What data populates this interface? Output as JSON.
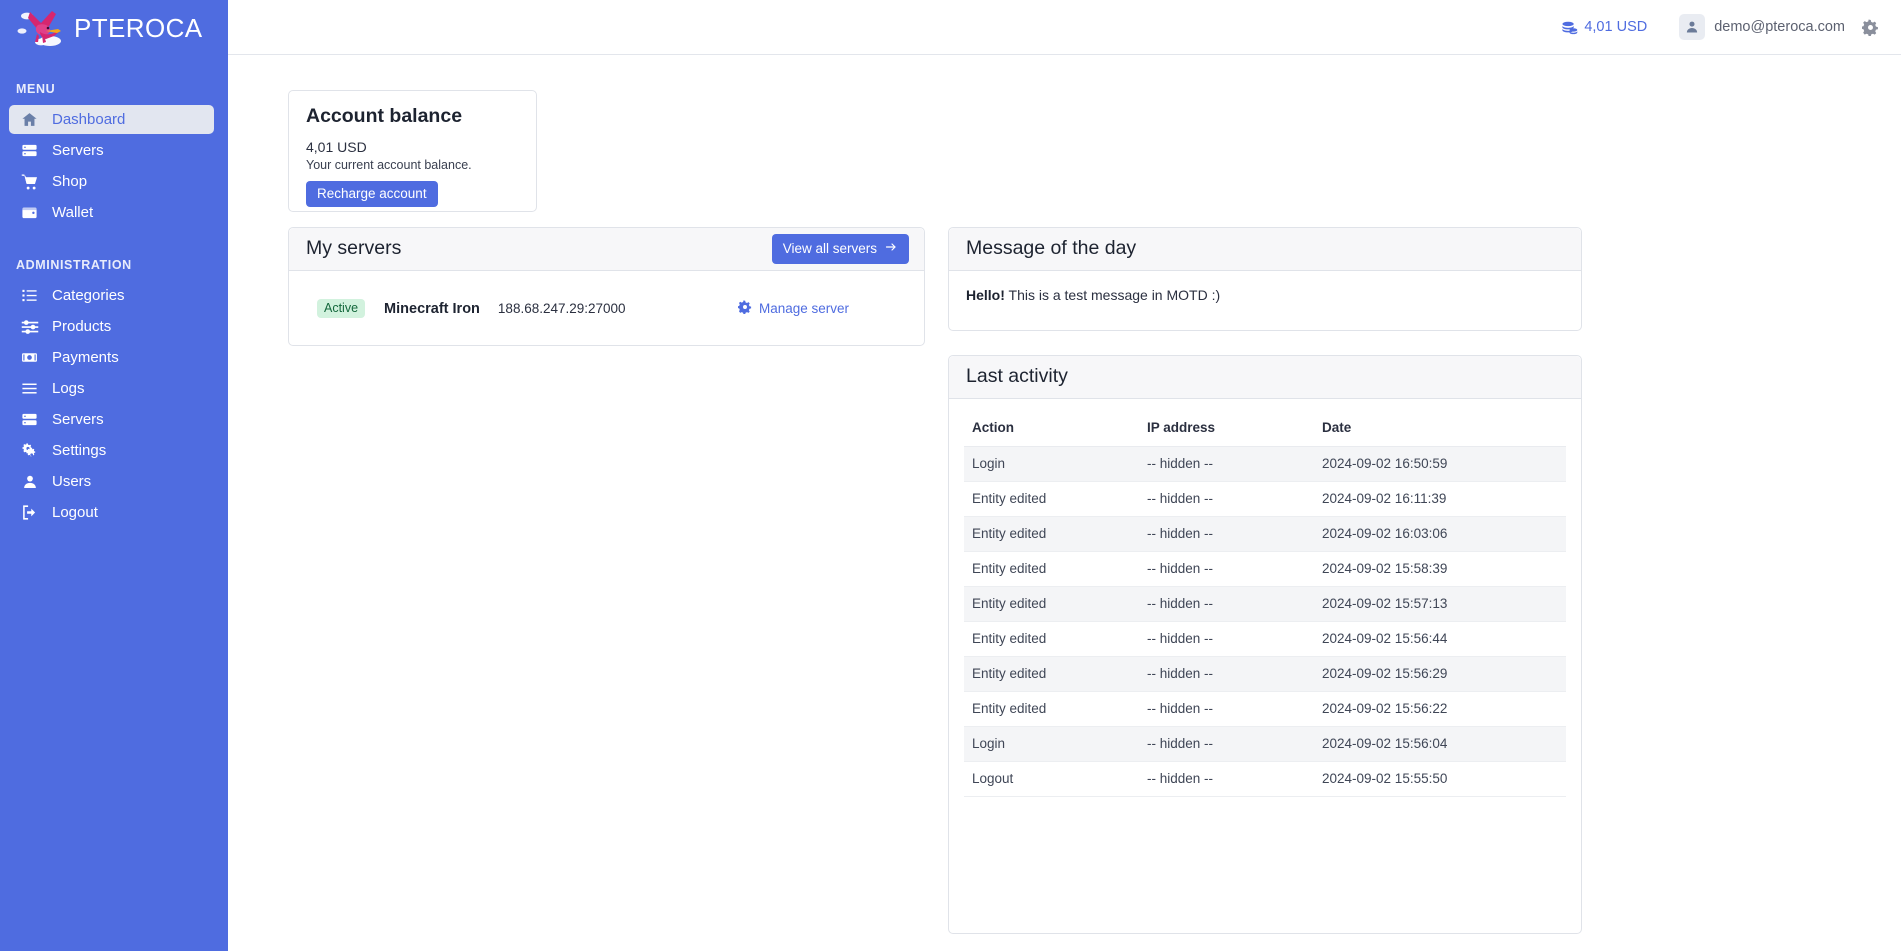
{
  "brand": {
    "name": "PTEROCA",
    "logo_icon": "pterodactyl-logo"
  },
  "sidebar": {
    "sections": [
      {
        "label": "MENU",
        "items": [
          {
            "label": "Dashboard",
            "icon": "home-icon",
            "active": true
          },
          {
            "label": "Servers",
            "icon": "server-icon",
            "active": false
          },
          {
            "label": "Shop",
            "icon": "shopping-cart-icon",
            "active": false
          },
          {
            "label": "Wallet",
            "icon": "wallet-icon",
            "active": false
          }
        ]
      },
      {
        "label": "ADMINISTRATION",
        "items": [
          {
            "label": "Categories",
            "icon": "list-icon",
            "active": false
          },
          {
            "label": "Products",
            "icon": "sliders-icon",
            "active": false
          },
          {
            "label": "Payments",
            "icon": "money-bill-icon",
            "active": false
          },
          {
            "label": "Logs",
            "icon": "bars-icon",
            "active": false
          },
          {
            "label": "Servers",
            "icon": "server-icon",
            "active": false
          },
          {
            "label": "Settings",
            "icon": "cogs-icon",
            "active": false
          },
          {
            "label": "Users",
            "icon": "user-icon",
            "active": false
          }
        ]
      }
    ],
    "logout": {
      "label": "Logout",
      "icon": "logout-icon"
    }
  },
  "topbar": {
    "balance": "4,01 USD",
    "balance_icon": "coins-icon",
    "user_email": "demo@pteroca.com",
    "avatar_icon": "user-icon",
    "settings_icon": "gear-icon"
  },
  "balance_card": {
    "title": "Account balance",
    "amount": "4,01 USD",
    "description": "Your current account balance.",
    "button_label": "Recharge account"
  },
  "servers_card": {
    "title": "My servers",
    "view_all_label": "View all servers",
    "view_all_icon": "arrow-right-icon",
    "rows": [
      {
        "status": "Active",
        "name": "Minecraft Iron",
        "address": "188.68.247.29:27000",
        "manage_label": "Manage server",
        "manage_icon": "gear-icon"
      }
    ]
  },
  "motd_card": {
    "title": "Message of the day",
    "message_bold": "Hello!",
    "message_rest": " This is a test message in MOTD :)"
  },
  "activity_card": {
    "title": "Last activity",
    "columns": [
      "Action",
      "IP address",
      "Date"
    ],
    "rows": [
      {
        "action": "Login",
        "ip": "-- hidden --",
        "date": "2024-09-02 16:50:59"
      },
      {
        "action": "Entity edited",
        "ip": "-- hidden --",
        "date": "2024-09-02 16:11:39"
      },
      {
        "action": "Entity edited",
        "ip": "-- hidden --",
        "date": "2024-09-02 16:03:06"
      },
      {
        "action": "Entity edited",
        "ip": "-- hidden --",
        "date": "2024-09-02 15:58:39"
      },
      {
        "action": "Entity edited",
        "ip": "-- hidden --",
        "date": "2024-09-02 15:57:13"
      },
      {
        "action": "Entity edited",
        "ip": "-- hidden --",
        "date": "2024-09-02 15:56:44"
      },
      {
        "action": "Entity edited",
        "ip": "-- hidden --",
        "date": "2024-09-02 15:56:29"
      },
      {
        "action": "Entity edited",
        "ip": "-- hidden --",
        "date": "2024-09-02 15:56:22"
      },
      {
        "action": "Login",
        "ip": "-- hidden --",
        "date": "2024-09-02 15:56:04"
      },
      {
        "action": "Logout",
        "ip": "-- hidden --",
        "date": "2024-09-02 15:55:50"
      }
    ]
  },
  "colors": {
    "sidebar_bg": "#4f6ce0",
    "accent": "#4f6ce0",
    "badge_active_bg": "#d2f2de",
    "badge_active_text": "#14683c",
    "card_head_bg": "#f7f7f9",
    "table_stripe": "#f4f5f7",
    "logo_pink": "#d6266f"
  }
}
